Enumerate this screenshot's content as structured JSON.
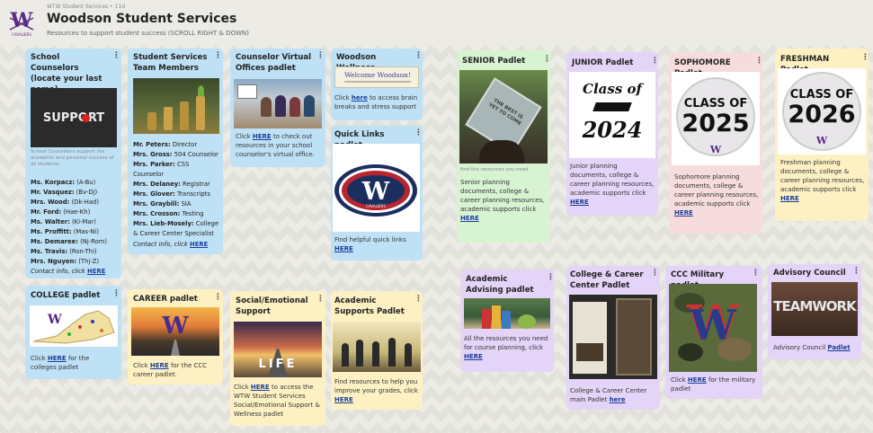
{
  "header": {
    "meta": "WTW Student Services • 11d",
    "title": "Woodson Student Services",
    "subtitle": "Resources to support student success (SCROLL RIGHT & DOWN)",
    "logo_text": "CAVALIERS"
  },
  "cards": {
    "counselors": {
      "title": "School Counselors (locate your last name)",
      "image_text": "SUPPORT",
      "note": "School Counselors support the academic and personal success of all students.",
      "list": [
        [
          "Ms. Korpacz:",
          "(A-Bu)"
        ],
        [
          "Mr. Vasquez:",
          "(Bv-Dj)"
        ],
        [
          "Mrs. Wood:",
          "(Dk-Had)"
        ],
        [
          "Mr. Ford:",
          "(Hae-Kh)"
        ],
        [
          "Ms. Walter:",
          "(Ki-Mar)"
        ],
        [
          "Ms. Proffitt:",
          "(Mas-Ni)"
        ],
        [
          "Ms. Demaree:",
          "(Nj-Rom)"
        ],
        [
          "Ms. Travis:",
          "(Ron-Thi)"
        ],
        [
          "Mrs. Nguyen:",
          "(Thj-Z)"
        ]
      ],
      "contact": "Contact info, click ",
      "link": "HERE"
    },
    "team": {
      "title": "Student Services Team Members",
      "list": [
        [
          "Mr. Peters:",
          "Director"
        ],
        [
          "Mrs. Gross:",
          "504 Counselor"
        ],
        [
          "Mrs. Parker:",
          "CSS"
        ],
        [
          "",
          "Counselor"
        ],
        [
          "Mrs. Delaney:",
          "Registrar"
        ],
        [
          "Mrs. Glover:",
          "Transcripts"
        ],
        [
          "Mrs. Graybill:",
          "SIA"
        ],
        [
          "Mrs. Crosson:",
          "Testing"
        ],
        [
          "Mrs. Lieb-Mosely:",
          "College"
        ],
        [
          "",
          "& Career Center Specialist"
        ]
      ],
      "contact": "Contact info, click ",
      "link": "HERE"
    },
    "virtual": {
      "title": "Counselor Virtual Offices padlet",
      "text_a": "Click ",
      "link": "HERE",
      "text_b": " to check out resources in your school counselor's virtual office."
    },
    "wellness": {
      "title": "Woodson Wellness",
      "banner": "Welcome Woodson!",
      "text_a": "Click ",
      "link": "here",
      "text_b": " to access brain breaks and stress support"
    },
    "quicklinks": {
      "title": "Quick Links padlet",
      "logo_letter": "W",
      "logo_sub": "CAVALIERS",
      "text": "Find helpful quick links ",
      "link": "HERE"
    },
    "senior": {
      "title": "SENIOR Padlet",
      "cap_text": "THE BEST IS YET TO COME",
      "note": "find the resources you need",
      "text": "Senior planning documents, college & career planning resources, academic supports click ",
      "link": "HERE"
    },
    "junior": {
      "title": "JUNIOR Padlet",
      "img_a": "Class of",
      "img_b": "2024",
      "text": "Junior planning documents, college & career planning resources, academic supports click ",
      "link": "HERE"
    },
    "sophomore": {
      "title": "SOPHOMORE Padlet",
      "img_a": "CLASS OF",
      "img_b": "2025",
      "text": "Sophomore planning documents, college & career planning resources, academic supports click ",
      "link": "HERE"
    },
    "freshman": {
      "title": "FRESHMAN Padlet",
      "img_a": "CLASS OF",
      "img_b": "2026",
      "text": "Freshman planning documents, college & career planning resources, academic supports click ",
      "link": "HERE"
    },
    "college": {
      "title": "COLLEGE padlet",
      "text_a": "Click ",
      "link": "HERE",
      "text_b": " for the colleges padlet"
    },
    "career": {
      "title": "CAREER padlet",
      "text_a": "Click ",
      "link": "HERE",
      "text_b": " for the CCC career padlet."
    },
    "sel": {
      "title": "Social/Emotional Support",
      "img_text": "LIFE",
      "text_a": "Click ",
      "link": "HERE",
      "text_b": " to access the WTW Student Services Social/Emotional Support & Wellness padlet"
    },
    "academic_supports": {
      "title": "Academic Supports Padlet",
      "text": "Find resources to help you improve your grades, click ",
      "link": "HERE"
    },
    "advising": {
      "title": "Academic Advising padlet",
      "text": "All the resources you need for course planning, click ",
      "link": "HERE"
    },
    "ccc": {
      "title": "College & Career Center Padlet",
      "text": "College & Career Center main Padlet ",
      "link": "here"
    },
    "military": {
      "title": "CCC Military padlet",
      "text_a": "Click ",
      "link": "HERE",
      "text_b": " for the military padlet"
    },
    "advisory": {
      "title": "Advisory Council",
      "img_text": "TEAMWORK",
      "text": "Advisory Council ",
      "link": "Padlet"
    }
  },
  "menu_icon": "⋮",
  "colors": {
    "blue": "#bfe1f6",
    "yellow": "#fdf1c4",
    "green": "#d8f3d2",
    "purple": "#e4d4f8",
    "pink": "#f6dcdc",
    "school_purple": "#5b2a86",
    "link": "#1a3d9a"
  }
}
